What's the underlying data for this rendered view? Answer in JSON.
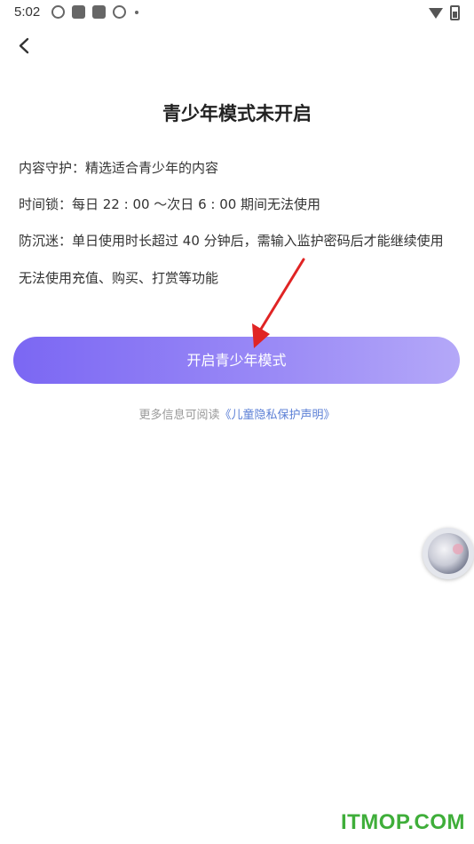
{
  "status_bar": {
    "time": "5:02",
    "left_icons": [
      "app-icon",
      "app-icon",
      "app-icon",
      "app-icon"
    ],
    "right_icons": [
      "wifi-icon",
      "battery-icon"
    ]
  },
  "nav": {
    "back_icon": "chevron-left-icon"
  },
  "main": {
    "title": "青少年模式未开启",
    "info_lines": [
      "内容守护：精选适合青少年的内容",
      "时间锁：每日 22 : 00 ～次日 6 : 00 期间无法使用",
      "防沉迷：单日使用时长超过 40 分钟后，需输入监护密码后才能继续使用",
      "无法使用充值、购买、打赏等功能"
    ],
    "enable_button_label": "开启青少年模式",
    "more_info_prefix": "更多信息可阅读",
    "privacy_link_text": "《儿童隐私保护声明》"
  },
  "floating_button": {
    "icon": "avatar-icon"
  },
  "watermark": {
    "text": "ITMOP.COM"
  },
  "colors": {
    "button_gradient_start": "#7b67f3",
    "button_gradient_end": "#b4a8f8",
    "link": "#5b7fd6",
    "annotation_arrow": "#e02424",
    "watermark": "#3fae3a"
  }
}
